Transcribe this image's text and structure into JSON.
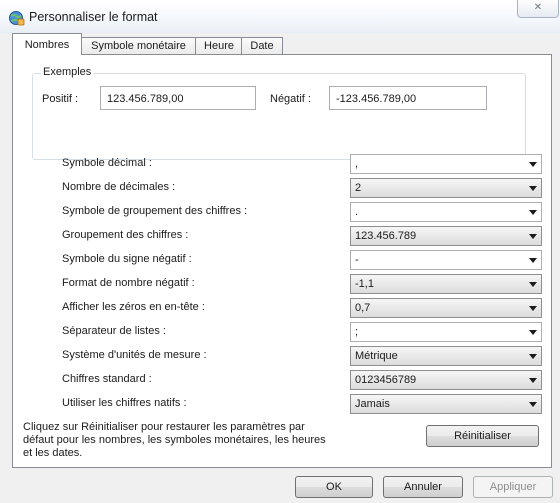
{
  "window": {
    "title": "Personnaliser le format",
    "close_glyph": "✕"
  },
  "tabs": [
    {
      "label": "Nombres"
    },
    {
      "label": "Symbole monétaire"
    },
    {
      "label": "Heure"
    },
    {
      "label": "Date"
    }
  ],
  "examples": {
    "legend": "Exemples",
    "positive_label": "Positif :",
    "positive_value": "123.456.789,00",
    "negative_label": "Négatif :",
    "negative_value": "-123.456.789,00"
  },
  "settings": [
    {
      "label": "Symbole décimal :",
      "value": ","
    },
    {
      "label": "Nombre de décimales :",
      "value": "2"
    },
    {
      "label": "Symbole de groupement des chiffres :",
      "value": "."
    },
    {
      "label": "Groupement des chiffres :",
      "value": "123.456.789"
    },
    {
      "label": "Symbole du signe négatif :",
      "value": "-"
    },
    {
      "label": "Format de nombre négatif :",
      "value": "-1,1"
    },
    {
      "label": "Afficher les zéros en en-tête :",
      "value": "0,7"
    },
    {
      "label": "Séparateur de listes :",
      "value": ";"
    },
    {
      "label": "Système d'unités de mesure :",
      "value": "Métrique"
    },
    {
      "label": "Chiffres standard :",
      "value": "0123456789"
    },
    {
      "label": "Utiliser les chiffres natifs :",
      "value": "Jamais"
    }
  ],
  "info": {
    "line1": "Cliquez sur Réinitialiser pour restaurer les paramètres par",
    "line2": "défaut pour les nombres, les symboles monétaires, les heures",
    "line3": "et les dates."
  },
  "buttons": {
    "reset": "Réinitialiser",
    "ok": "OK",
    "cancel": "Annuler",
    "apply": "Appliquer"
  },
  "icons": {
    "title_icon": "globe-settings-icon",
    "dropdown_icon": "chevron-down-icon"
  }
}
